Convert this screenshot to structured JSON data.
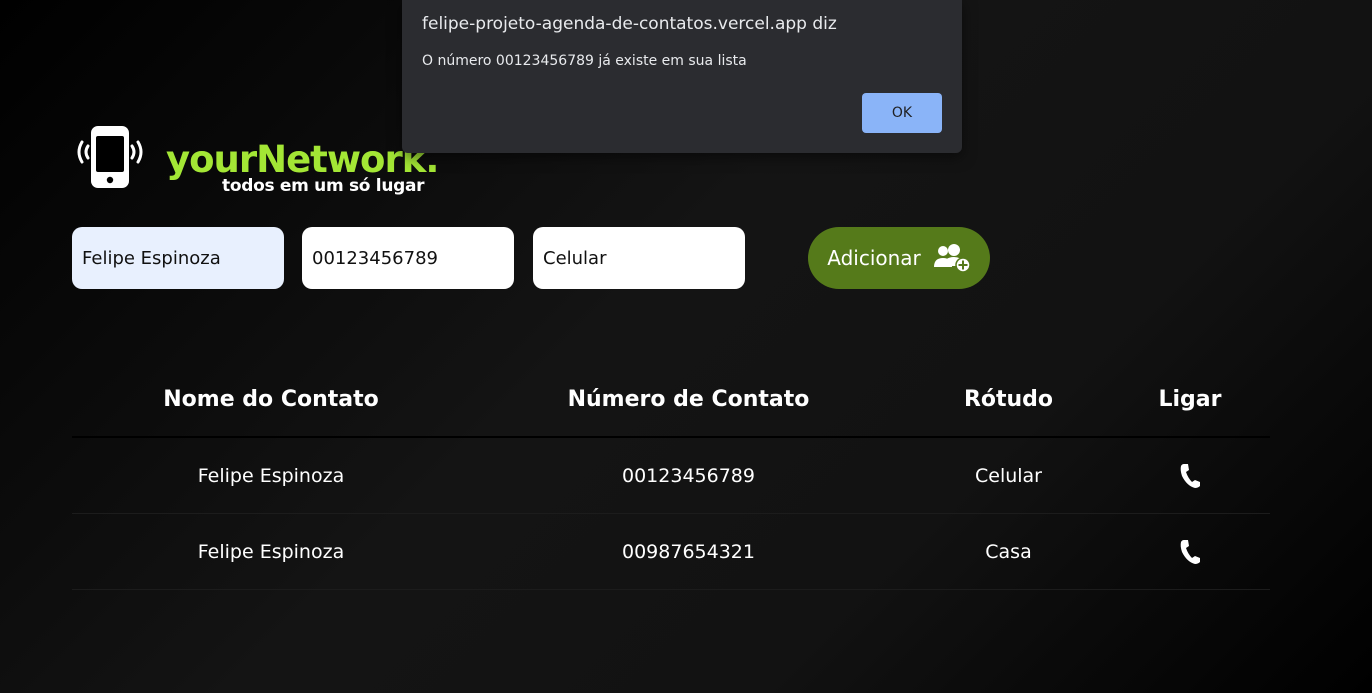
{
  "logo": {
    "brand": "yourNetwork.",
    "tagline": "todos em um só lugar",
    "icon": "phone-ringing-icon",
    "brand_color": "#a3e635"
  },
  "form": {
    "name_value": "Felipe Espinoza",
    "number_value": "00123456789",
    "label_value": "Celular",
    "add_label": "Adicionar",
    "add_icon": "add-user-icon",
    "add_color": "#557a1a"
  },
  "table": {
    "headers": [
      "Nome do Contato",
      "Número de Contato",
      "Rótudo",
      "Ligar"
    ],
    "rows": [
      {
        "name": "Felipe Espinoza",
        "number": "00123456789",
        "label": "Celular",
        "call_icon": "phone-icon"
      },
      {
        "name": "Felipe Espinoza",
        "number": "00987654321",
        "label": "Casa",
        "call_icon": "phone-icon"
      }
    ]
  },
  "alert": {
    "origin": "felipe-projeto-agenda-de-contatos.vercel.app diz",
    "message": "O número 00123456789 já existe em sua lista",
    "ok_label": "OK",
    "ok_color": "#8ab4f8"
  }
}
